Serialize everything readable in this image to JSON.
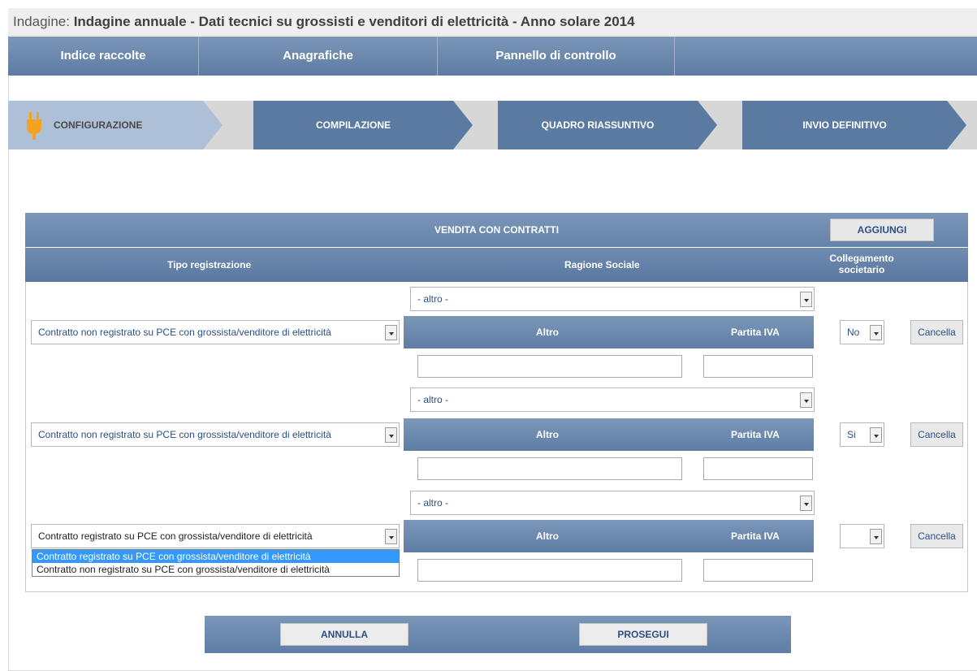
{
  "title": {
    "prefix": "Indagine: ",
    "name": "Indagine annuale - Dati tecnici su grossisti e venditori di elettricità - Anno solare 2014"
  },
  "nav": [
    "Indice raccolte",
    "Anagrafiche",
    "Pannello di controllo"
  ],
  "steps": [
    "CONFIGURAZIONE",
    "COMPILAZIONE",
    "QUADRO RIASSUNTIVO",
    "INVIO DEFINITIVO"
  ],
  "panel": {
    "title": "VENDITA CON CONTRATTI",
    "add_label": "AGGIUNGI",
    "col_tipo": "Tipo registrazione",
    "col_ragione": "Ragione Sociale",
    "col_collegamento": "Collegamento societario"
  },
  "rows": [
    {
      "tipo": "Contratto non registrato su PCE con grossista/venditore di elettricità",
      "ragione": "- altro -",
      "altro_label": "Altro",
      "piva_label": "Partita IVA",
      "collegamento": "No",
      "cancel": "Cancella"
    },
    {
      "tipo": "Contratto non registrato su PCE con grossista/venditore di elettricità",
      "ragione": "- altro -",
      "altro_label": "Altro",
      "piva_label": "Partita IVA",
      "collegamento": "Si",
      "cancel": "Cancella"
    },
    {
      "tipo": "Contratto registrato su PCE con grossista/venditore di elettricità",
      "ragione": "- altro -",
      "altro_label": "Altro",
      "piva_label": "Partita IVA",
      "collegamento": "",
      "cancel": "Cancella"
    }
  ],
  "dropdown_options": [
    "Contratto registrato su PCE con grossista/venditore di elettricità",
    "Contratto non registrato su PCE con grossista/venditore di elettricità"
  ],
  "buttons": {
    "cancel": "ANNULLA",
    "next": "PROSEGUI"
  },
  "colors": {
    "accent": "#5b7aa1",
    "step_active": "#adc0d8",
    "plug": "#f2a421",
    "highlight": "#3399ff"
  }
}
